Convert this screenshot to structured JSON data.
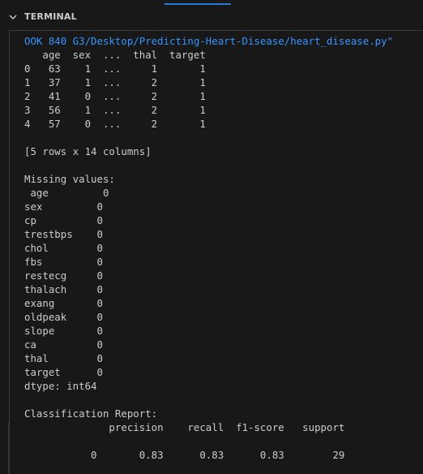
{
  "header": {
    "title": "TERMINAL"
  },
  "terminal": {
    "lines": [
      "OOK 840 G3/Desktop/Predicting-Heart-Disease/heart_disease.py\"",
      "   age  sex  ...  thal  target",
      "0   63    1  ...     1       1",
      "1   37    1  ...     2       1",
      "2   41    0  ...     2       1",
      "3   56    1  ...     2       1",
      "4   57    0  ...     2       1",
      "",
      "[5 rows x 14 columns]",
      "",
      "Missing values:",
      " age         0",
      "sex         0",
      "cp          0",
      "trestbps    0",
      "chol        0",
      "fbs         0",
      "restecg     0",
      "thalach     0",
      "exang       0",
      "oldpeak     0",
      "slope       0",
      "ca          0",
      "thal        0",
      "target      0",
      "dtype: int64",
      "",
      "Classification Report:",
      "              precision    recall  f1-score   support",
      "",
      "           0       0.83      0.83      0.83        29"
    ]
  },
  "colors": {
    "background": "#181818",
    "text": "#cccccc",
    "path": "#3794ff",
    "accent": "#2b79d0"
  }
}
